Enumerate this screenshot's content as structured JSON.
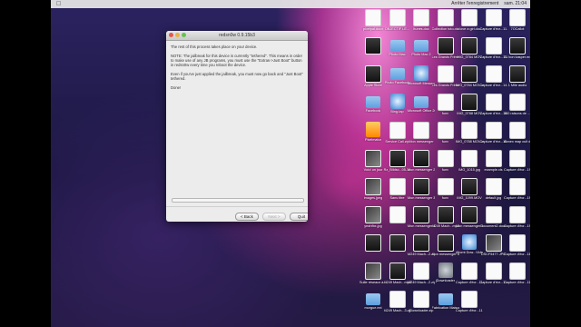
{
  "menubar": {
    "items": [
      "Arrêter l'enregistrement",
      "sam. 21:04"
    ]
  },
  "window": {
    "title": "redsn0w 0.9.15b3",
    "paragraphs": [
      "The rest of this process takes place on your device.",
      "NOTE: The jailbreak for this device is currently \"tethered\". This means in order to make use of any JB programs, you must use the \"Extras->Just Boot\" button in redsn0w every time you reboot the device.",
      "Even if you've just applied the jailbreak, you must now go back and \"Just Boot\" tethered."
    ],
    "status": "Done!",
    "buttons": {
      "back": "< Back",
      "next": "Next >",
      "quit": "Quit"
    }
  },
  "desktop_icons": [
    {
      "label": "pixelpal.docx",
      "type": "doc"
    },
    {
      "label": "OBJECTIF LE...",
      "type": "doc"
    },
    {
      "label": "Itunes.doc",
      "type": "doc"
    },
    {
      "label": "Collection tuto.docx",
      "type": "doc"
    },
    {
      "label": "I love a girl.doc",
      "type": "doc"
    },
    {
      "label": "Capture d'écr...11.21",
      "type": "doc"
    },
    {
      "label": "7OCallot",
      "type": "doc"
    },
    {
      "label": "",
      "type": "media"
    },
    {
      "label": "Photo Mac",
      "type": "folder"
    },
    {
      "label": "Photo Mac 2",
      "type": "folder"
    },
    {
      "label": "Les Grands Frères.avi",
      "type": "media"
    },
    {
      "label": "IMG_0784 MOV",
      "type": "media"
    },
    {
      "label": "Capture d'écr...11.23",
      "type": "doc"
    },
    {
      "label": "01 bon kasper.m4a",
      "type": "media"
    },
    {
      "label": "Apple Store",
      "type": "media"
    },
    {
      "label": "Photo Facebook",
      "type": "folder"
    },
    {
      "label": "Microsoft Messenger",
      "type": "web"
    },
    {
      "label": "Les Grands Frères act.zip",
      "type": "doc"
    },
    {
      "label": "IMG_0784 MOV.zip",
      "type": "media"
    },
    {
      "label": "Capture d'écr...14.04",
      "type": "doc"
    },
    {
      "label": "1 Mile audio",
      "type": "media"
    },
    {
      "label": "Facebook",
      "type": "folder"
    },
    {
      "label": "Bing-tap",
      "type": "web"
    },
    {
      "label": "Microsoft Office 2011",
      "type": "folder"
    },
    {
      "label": "funv",
      "type": "doc"
    },
    {
      "label": "IMG_0788 MOV",
      "type": "media"
    },
    {
      "label": "Capture d'écr...15.21",
      "type": "doc"
    },
    {
      "label": "100 raisons de ...s.doc",
      "type": "doc"
    },
    {
      "label": "Pixelmator",
      "type": "pink"
    },
    {
      "label": "Service Call.zip",
      "type": "doc"
    },
    {
      "label": "Mon messenger",
      "type": "doc"
    },
    {
      "label": "funv",
      "type": "doc"
    },
    {
      "label": "IMG_0788 MOV.zip",
      "type": "doc"
    },
    {
      "label": "Capture d'écr...15.21",
      "type": "doc"
    },
    {
      "label": "Annex map cult d'oeu",
      "type": "doc"
    },
    {
      "label": "Voici un jour",
      "type": "img"
    },
    {
      "label": "Rz_Bildsc...05-14",
      "type": "media"
    },
    {
      "label": "Mon messenger 2",
      "type": "media"
    },
    {
      "label": "funv",
      "type": "doc"
    },
    {
      "label": "IMG_1015.jpg",
      "type": "doc"
    },
    {
      "label": "example.xls",
      "type": "doc"
    },
    {
      "label": "Capture d'écr...19.07",
      "type": "doc"
    },
    {
      "label": "images.jpeg",
      "type": "img"
    },
    {
      "label": "Sans titre",
      "type": "doc"
    },
    {
      "label": "Mon messenger 3",
      "type": "media"
    },
    {
      "label": "funv",
      "type": "doc"
    },
    {
      "label": "IMG_1099.MOV",
      "type": "media"
    },
    {
      "label": "default.jpg",
      "type": "doc"
    },
    {
      "label": "Capture d'écr...19.30",
      "type": "doc"
    },
    {
      "label": "yeahfbx.jpg",
      "type": "img"
    },
    {
      "label": "",
      "type": "doc"
    },
    {
      "label": "Mon messenger 4",
      "type": "media"
    },
    {
      "label": "M249 Mach...mp3",
      "type": "media"
    },
    {
      "label": "Mon messenger 5",
      "type": "media"
    },
    {
      "label": "Document2.docx",
      "type": "doc"
    },
    {
      "label": "Capture d'écr...19.20",
      "type": "doc"
    },
    {
      "label": "",
      "type": "media"
    },
    {
      "label": "",
      "type": "media"
    },
    {
      "label": "M249 Mach...2.zip",
      "type": "media"
    },
    {
      "label": "Mon messenger 6",
      "type": "media"
    },
    {
      "label": "Allomt Dow...Video",
      "type": "web"
    },
    {
      "label": "DSCF5477.JPG",
      "type": "img"
    },
    {
      "label": "Capture d'écr...11.45",
      "type": "doc"
    },
    {
      "label": "Suite réseaux a...zip",
      "type": "img"
    },
    {
      "label": "M249 Mach...mp3",
      "type": "media"
    },
    {
      "label": "M249 Mach...2.zip",
      "type": "doc"
    },
    {
      "label": "jDownloader",
      "type": "gear"
    },
    {
      "label": "Capture d'écr...11.45",
      "type": "doc"
    },
    {
      "label": "Capture d'écr...11.45",
      "type": "doc"
    },
    {
      "label": "Capture d'écr...11.47",
      "type": "doc"
    },
    {
      "label": "morgue.ext",
      "type": "folder"
    },
    {
      "label": "M249 Mach...3.zip",
      "type": "doc"
    },
    {
      "label": "jDownloader.zip",
      "type": "doc"
    },
    {
      "label": "Fabrication Maison !!!",
      "type": "folder"
    },
    {
      "label": "Capture d'écr...11.47",
      "type": "doc"
    }
  ]
}
